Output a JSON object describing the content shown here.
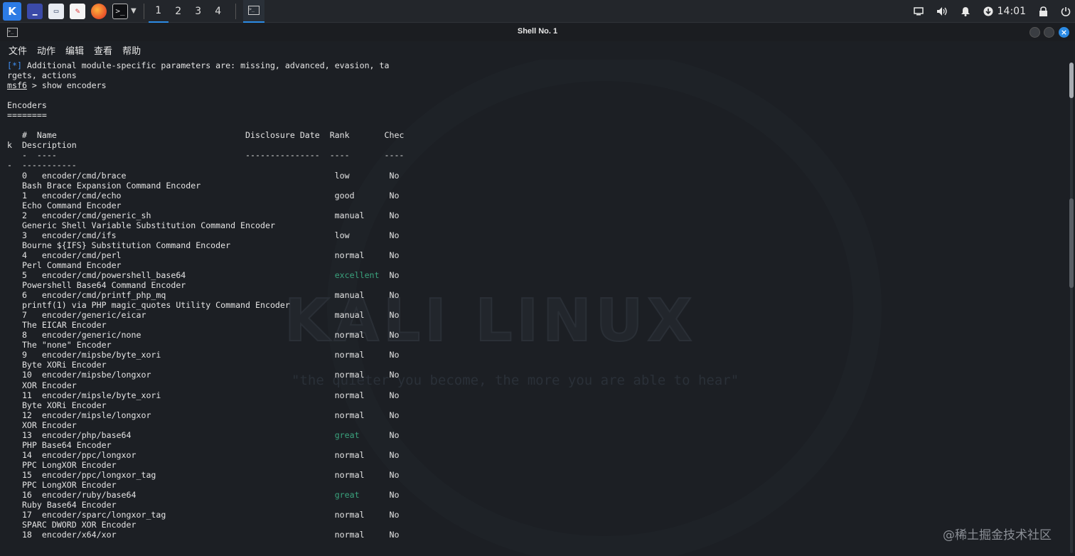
{
  "taskbar": {
    "workspaces": [
      "1",
      "2",
      "3",
      "4"
    ],
    "active_workspace": "1",
    "clock": "14:01",
    "icons": [
      "kali-menu-icon",
      "desktop-icon",
      "file-manager-icon",
      "text-editor-icon",
      "firefox-icon",
      "terminal-icon",
      "chevron-down-icon",
      "terminal-window-icon",
      "display-icon",
      "volume-icon",
      "bell-icon",
      "update-icon",
      "lock-icon",
      "power-icon"
    ]
  },
  "window": {
    "title": "Shell No. 1"
  },
  "menu": [
    "文件",
    "动作",
    "编辑",
    "查看",
    "帮助"
  ],
  "terminal": {
    "lines": [
      {
        "segs": [
          {
            "t": "[*]",
            "c": "cyan"
          },
          {
            "t": " Additional module-specific parameters are: missing, advanced, evasion, ta"
          }
        ]
      },
      {
        "segs": [
          {
            "t": "rgets, actions"
          }
        ]
      },
      {
        "segs": [
          {
            "t": "msf6",
            "c": "under"
          },
          {
            "t": " > show encoders"
          }
        ]
      },
      {
        "segs": [
          {
            "t": ""
          }
        ]
      },
      {
        "segs": [
          {
            "t": "Encoders"
          }
        ]
      },
      {
        "segs": [
          {
            "t": "========"
          }
        ]
      },
      {
        "segs": [
          {
            "t": ""
          }
        ]
      },
      {
        "segs": [
          {
            "t": "   #  Name                                      Disclosure Date  Rank       Chec"
          }
        ]
      },
      {
        "segs": [
          {
            "t": "k  Description"
          }
        ]
      },
      {
        "segs": [
          {
            "t": "   -  ----                                      ---------------  ----       ----"
          }
        ]
      },
      {
        "segs": [
          {
            "t": "-  -----------"
          }
        ]
      },
      {
        "segs": [
          {
            "t": "   0   encoder/cmd/brace                                          low        No"
          }
        ]
      },
      {
        "segs": [
          {
            "t": "   Bash Brace Expansion Command Encoder"
          }
        ]
      },
      {
        "segs": [
          {
            "t": "   1   encoder/cmd/echo                                           good       No"
          }
        ]
      },
      {
        "segs": [
          {
            "t": "   Echo Command Encoder"
          }
        ]
      },
      {
        "segs": [
          {
            "t": "   2   encoder/cmd/generic_sh                                     manual     No"
          }
        ]
      },
      {
        "segs": [
          {
            "t": "   Generic Shell Variable Substitution Command Encoder"
          }
        ]
      },
      {
        "segs": [
          {
            "t": "   3   encoder/cmd/ifs                                            low        No"
          }
        ]
      },
      {
        "segs": [
          {
            "t": "   Bourne ${IFS} Substitution Command Encoder"
          }
        ]
      },
      {
        "segs": [
          {
            "t": "   4   encoder/cmd/perl                                           normal     No"
          }
        ]
      },
      {
        "segs": [
          {
            "t": "   Perl Command Encoder"
          }
        ]
      },
      {
        "segs": [
          {
            "t": "   5   encoder/cmd/powershell_base64                              "
          },
          {
            "t": "excellent",
            "c": "green"
          },
          {
            "t": "  No"
          }
        ]
      },
      {
        "segs": [
          {
            "t": "   Powershell Base64 Command Encoder"
          }
        ]
      },
      {
        "segs": [
          {
            "t": "   6   encoder/cmd/printf_php_mq                                  manual     No"
          }
        ]
      },
      {
        "segs": [
          {
            "t": "   printf(1) via PHP magic_quotes Utility Command Encoder"
          }
        ]
      },
      {
        "segs": [
          {
            "t": "   7   encoder/generic/eicar                                      manual     No"
          }
        ]
      },
      {
        "segs": [
          {
            "t": "   The EICAR Encoder"
          }
        ]
      },
      {
        "segs": [
          {
            "t": "   8   encoder/generic/none                                       normal     No"
          }
        ]
      },
      {
        "segs": [
          {
            "t": "   The \"none\" Encoder"
          }
        ]
      },
      {
        "segs": [
          {
            "t": "   9   encoder/mipsbe/byte_xori                                   normal     No"
          }
        ]
      },
      {
        "segs": [
          {
            "t": "   Byte XORi Encoder"
          }
        ]
      },
      {
        "segs": [
          {
            "t": "   10  encoder/mipsbe/longxor                                     normal     No"
          }
        ]
      },
      {
        "segs": [
          {
            "t": "   XOR Encoder"
          }
        ]
      },
      {
        "segs": [
          {
            "t": "   11  encoder/mipsle/byte_xori                                   normal     No"
          }
        ]
      },
      {
        "segs": [
          {
            "t": "   Byte XORi Encoder"
          }
        ]
      },
      {
        "segs": [
          {
            "t": "   12  encoder/mipsle/longxor                                     normal     No"
          }
        ]
      },
      {
        "segs": [
          {
            "t": "   XOR Encoder"
          }
        ]
      },
      {
        "segs": [
          {
            "t": "   13  encoder/php/base64                                         "
          },
          {
            "t": "great",
            "c": "green"
          },
          {
            "t": "      No"
          }
        ]
      },
      {
        "segs": [
          {
            "t": "   PHP Base64 Encoder"
          }
        ]
      },
      {
        "segs": [
          {
            "t": "   14  encoder/ppc/longxor                                        normal     No"
          }
        ]
      },
      {
        "segs": [
          {
            "t": "   PPC LongXOR Encoder"
          }
        ]
      },
      {
        "segs": [
          {
            "t": "   15  encoder/ppc/longxor_tag                                    normal     No"
          }
        ]
      },
      {
        "segs": [
          {
            "t": "   PPC LongXOR Encoder"
          }
        ]
      },
      {
        "segs": [
          {
            "t": "   16  encoder/ruby/base64                                        "
          },
          {
            "t": "great",
            "c": "green"
          },
          {
            "t": "      No"
          }
        ]
      },
      {
        "segs": [
          {
            "t": "   Ruby Base64 Encoder"
          }
        ]
      },
      {
        "segs": [
          {
            "t": "   17  encoder/sparc/longxor_tag                                  normal     No"
          }
        ]
      },
      {
        "segs": [
          {
            "t": "   SPARC DWORD XOR Encoder"
          }
        ]
      },
      {
        "segs": [
          {
            "t": "   18  encoder/x64/xor                                            normal     No"
          }
        ]
      }
    ]
  },
  "wallpaper": {
    "title": "KALI LINUX",
    "tagline": "\"the quieter you become, the more you are able to hear\""
  },
  "site_watermark": "@稀土掘金技术社区",
  "colors": {
    "accent": "#2c8be5",
    "prompt_bracket": "#3f8ff2",
    "rank_green": "#3aa17c",
    "background": "#1c1f24"
  }
}
